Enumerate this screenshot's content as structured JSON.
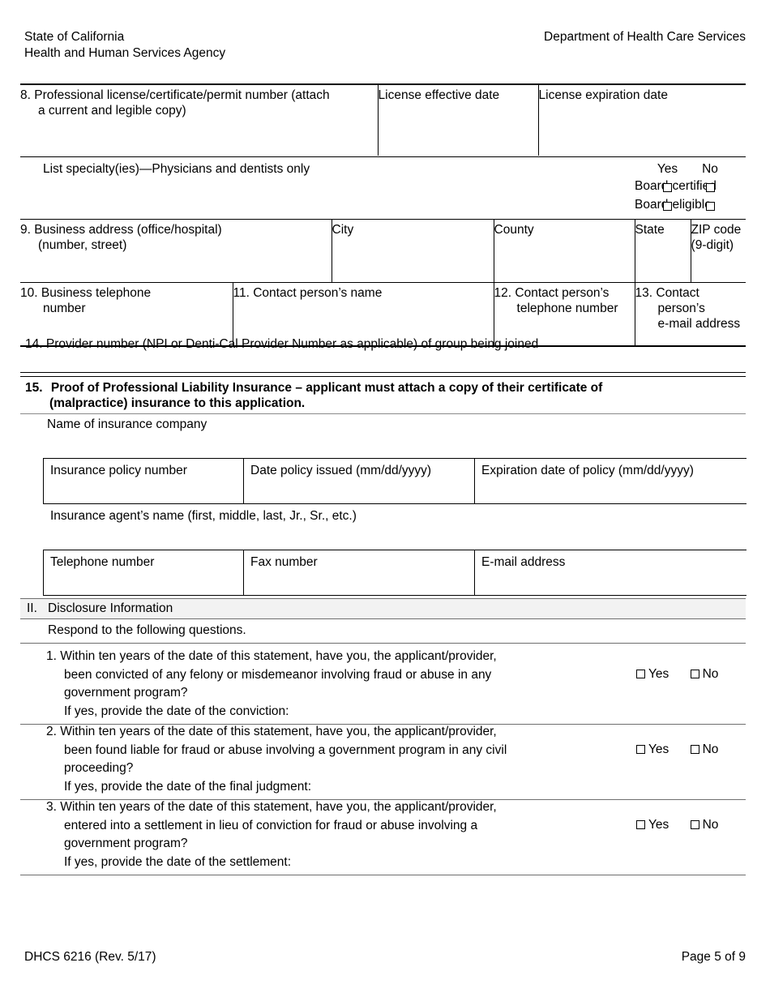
{
  "header": {
    "left_line1": "State of California",
    "left_line2": "Health and Human Services Agency",
    "right_line1": "Department of Health Care Services"
  },
  "item8": {
    "label": "8. Professional license/certificate/permit number (attach a current and legible copy)",
    "label_line1": "8. Professional license/certificate/permit number (attach",
    "label_line2": "a current and legible copy)",
    "effective_date_label": "License effective date",
    "expiration_date_label": "License expiration date",
    "specialty_label": "List specialty(ies)—Physicians and dentists only",
    "yes_label": "Yes",
    "no_label": "No",
    "board_certified_label": "Board-certified",
    "board_eligible_label": "Board-eligible"
  },
  "item9": {
    "label_line1": "9. Business address (office/hospital)",
    "label_line2": "(number, street)",
    "city_label": "City",
    "county_label": "County",
    "state_label": "State",
    "zip_label": "ZIP code (9-digit)"
  },
  "contact_row": {
    "item10_line1": "10. Business telephone",
    "item10_line2": "number",
    "item11": "11. Contact person’s name",
    "item12_line1": "12. Contact person’s",
    "item12_line2": "telephone number",
    "item13_line1": "13. Contact person’s",
    "item13_line2": "e-mail address"
  },
  "item14": {
    "label": "14. Provider number (NPI or Denti-Cal Provider Number as applicable) of group being joined"
  },
  "item15": {
    "number": "15.",
    "line1": "Proof of Professional Liability Insurance – applicant must attach a copy of their certificate of",
    "line2": "(malpractice) insurance to this application.",
    "company_label": "Name of insurance company",
    "policy_number_label": "Insurance policy number",
    "date_issued_label": "Date policy issued (mm/dd/yyyy)",
    "expiration_label": "Expiration date of policy (mm/dd/yyyy)",
    "agent_name_label": "Insurance agent’s name (first, middle, last, Jr., Sr., etc.)",
    "telephone_label": "Telephone number",
    "fax_label": "Fax number",
    "email_label": "E-mail address"
  },
  "section2": {
    "roman": "II.",
    "title": "Disclosure Information",
    "instruction": "Respond to the following questions.",
    "yes_label": "Yes",
    "no_label": "No",
    "questions": [
      {
        "number": "1.",
        "line1": "1. Within ten years of the date of this statement, have you, the applicant/provider,",
        "line2": "been convicted of any felony or misdemeanor involving fraud or abuse in any",
        "line3": "government program?",
        "ifyes": "If yes, provide the date of the conviction:"
      },
      {
        "number": "2.",
        "line1": "2. Within ten years of the date of this statement, have you, the applicant/provider,",
        "line2": "been found liable for fraud or abuse involving a government program in any civil",
        "line3": "proceeding?",
        "ifyes": "If yes, provide the date of the final judgment:"
      },
      {
        "number": "3.",
        "line1": "3. Within ten years of the date of this statement, have you, the applicant/provider,",
        "line2": "entered into a settlement in lieu of conviction for fraud or abuse involving a",
        "line3": "government program?",
        "ifyes": "If yes, provide the date of the settlement:"
      }
    ]
  },
  "footer": {
    "form_id": "DHCS 6216 (Rev. 5/17)",
    "page": "Page 5 of 9"
  },
  "colors": {
    "rule_dark": "#000000",
    "rule_gray": "#6e6e6e",
    "section_bar_bg": "#f2f2f2"
  }
}
